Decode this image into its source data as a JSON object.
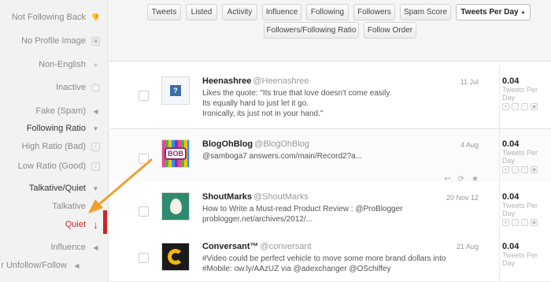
{
  "sidebar": {
    "not_following_back": "Not Following Back",
    "no_profile_image": "No Profile Image",
    "non_english": "Non-English",
    "inactive": "Inactive",
    "fake_spam": "Fake (Spam)",
    "following_ratio": "Following Ratio",
    "high_ratio": "High Ratio (Bad)",
    "low_ratio": "Low Ratio (Good)",
    "talkative_quiet": "Talkative/Quiet",
    "talkative": "Talkative",
    "quiet": "Quiet",
    "influence": "Influence",
    "unfollow_follow": "r Unfollow/Follow"
  },
  "filters": {
    "tweets": "Tweets",
    "listed": "Listed",
    "activity": "Activity",
    "influence": "Influence",
    "following": "Following",
    "followers": "Followers",
    "spam_score": "Spam Score",
    "tweets_per_day": "Tweets Per Day",
    "active_caret": "▲",
    "ff_ratio": "Followers/Following Ratio",
    "follow_order": "Follow Order"
  },
  "tweets": [
    {
      "name": "Heenashree",
      "handle": "@Heenashree",
      "date": "11 Jul",
      "text": [
        "Likes the quote: \"Its true that love doesn't come easily.",
        "Its equally hard to just let it go.",
        "Ironically, its just not in your hand.\""
      ],
      "avatar_text": "?",
      "value": "0.04",
      "unit1": "Tweets Per",
      "unit2": "Day"
    },
    {
      "name": "BlogOhBlog",
      "handle": "@BlogOhBlog",
      "date": "4 Aug",
      "text": [
        "@samboga7 answers.com/main/Record2?a..."
      ],
      "avatar_text": "BOB",
      "value": "0.04",
      "unit1": "Tweets Per",
      "unit2": "Day"
    },
    {
      "name": "ShoutMarks",
      "handle": "@ShoutMarks",
      "date": "20 Nov 12",
      "text": [
        "How to Write a Must-read Product Review : @ProBlogger",
        "problogger.net/archives/2012/..."
      ],
      "avatar_text": "",
      "value": "0.04",
      "unit1": "Tweets Per",
      "unit2": "Day"
    },
    {
      "name": "Conversant™",
      "handle": "@conversant",
      "date": "21 Aug",
      "text": [
        "#Video could be perfect vehicle to move some more brand dollars into",
        "#Mobile: ow.ly/AAzUZ via @adexchanger @OSchiffey"
      ],
      "avatar_text": "",
      "value": "0.04",
      "unit1": "Tweets Per",
      "unit2": "Day"
    }
  ],
  "colors": {
    "accent_red": "#c62828",
    "annotation_orange": "#f0a030"
  }
}
